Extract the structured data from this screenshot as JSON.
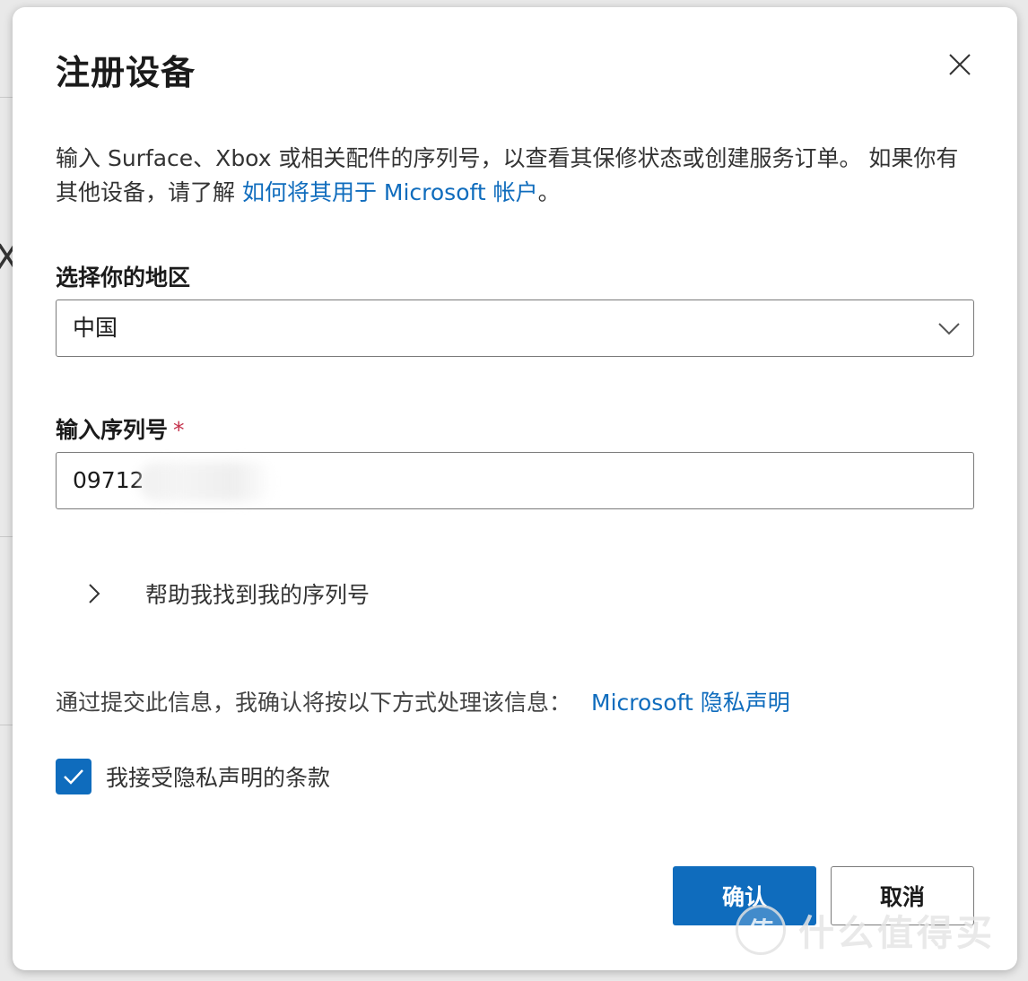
{
  "dialog": {
    "title": "注册设备",
    "close_icon": "close-icon",
    "description_text": "输入 Surface、Xbox 或相关配件的序列号，以查看其保修状态或创建服务订单。 如果你有其他设备，请了解 ",
    "description_link": "如何将其用于 Microsoft 帐户",
    "description_end": "。"
  },
  "region": {
    "label": "选择你的地区",
    "value": "中国",
    "icon": "chevron-down-icon"
  },
  "serial": {
    "label": "输入序列号",
    "required_mark": "*",
    "value": "09712"
  },
  "help": {
    "label": "帮助我找到我的序列号",
    "icon": "chevron-right-icon"
  },
  "privacy": {
    "text": "通过提交此信息，我确认将按以下方式处理该信息：",
    "link": "Microsoft 隐私声明"
  },
  "consent": {
    "label": "我接受隐私声明的条款",
    "checked": true
  },
  "buttons": {
    "confirm": "确认",
    "cancel": "取消"
  },
  "watermark": {
    "logo_char": "值",
    "text": "什么值得买"
  },
  "colors": {
    "accent": "#0f6cbd",
    "required": "#c4314b"
  }
}
